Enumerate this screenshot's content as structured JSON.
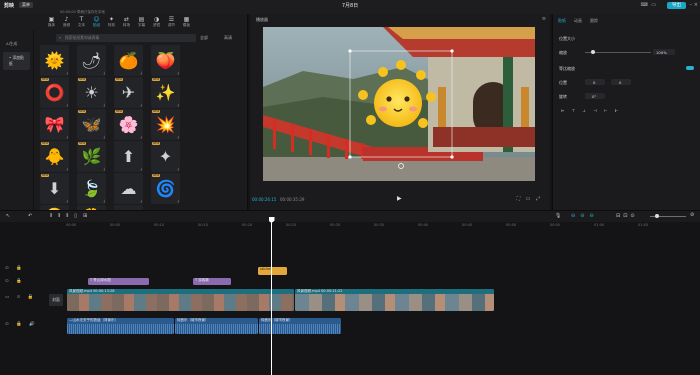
{
  "app": {
    "name": "剪映",
    "menu": "菜单",
    "project_title": "7月8日",
    "export": "导出",
    "autosave": "00:00:00 草稿已保存在本地"
  },
  "tools": [
    {
      "label": "媒体",
      "icon": "media-icon"
    },
    {
      "label": "音频",
      "icon": "audio-icon"
    },
    {
      "label": "文本",
      "icon": "text-icon"
    },
    {
      "label": "贴纸",
      "icon": "sticker-icon",
      "active": true
    },
    {
      "label": "特效",
      "icon": "effects-icon"
    },
    {
      "label": "转场",
      "icon": "transition-icon"
    },
    {
      "label": "字幕",
      "icon": "caption-icon"
    },
    {
      "label": "滤镜",
      "icon": "filter-icon"
    },
    {
      "label": "调节",
      "icon": "adjust-icon"
    },
    {
      "label": "模板",
      "icon": "template-icon"
    }
  ],
  "sidebar": {
    "ai": "AI生成",
    "items": [
      {
        "label": "• 添加贴纸",
        "active": true
      }
    ]
  },
  "search": {
    "placeholder": "搜索贴纸素材或表情"
  },
  "filters": {
    "all": "全部",
    "size": "高清"
  },
  "stickers": [
    {
      "emoji": "🌞",
      "badge": ""
    },
    {
      "emoji": "🌶",
      "badge": ""
    },
    {
      "emoji": "🍊",
      "badge": ""
    },
    {
      "emoji": "🍑",
      "badge": ""
    },
    {
      "emoji": "⭕",
      "badge": "NEW"
    },
    {
      "emoji": "☀",
      "badge": "NEW"
    },
    {
      "emoji": "✈",
      "badge": "NEW"
    },
    {
      "emoji": "✨",
      "badge": "NEW"
    },
    {
      "emoji": "🎀",
      "badge": ""
    },
    {
      "emoji": "🦋",
      "badge": "NEW"
    },
    {
      "emoji": "🌸",
      "badge": "NEW"
    },
    {
      "emoji": "💥",
      "badge": "NEW"
    },
    {
      "emoji": "🐥",
      "badge": "NEW"
    },
    {
      "emoji": "🌿",
      "badge": "NEW"
    },
    {
      "emoji": "⬆",
      "badge": ""
    },
    {
      "emoji": "✦",
      "badge": "NEW"
    },
    {
      "emoji": "⬇",
      "badge": "NEW"
    },
    {
      "emoji": "🍃",
      "badge": ""
    },
    {
      "emoji": "☁",
      "badge": ""
    },
    {
      "emoji": "🌀",
      "badge": "NEW"
    },
    {
      "emoji": "🟡",
      "badge": ""
    },
    {
      "emoji": "🌼",
      "badge": ""
    },
    {
      "emoji": "〰",
      "badge": ""
    }
  ],
  "player": {
    "title": "播放器",
    "timecode": "00:00:26:15",
    "duration": "00:00:35:29"
  },
  "props": {
    "tabs": [
      "贴纸",
      "动画",
      "跟踪"
    ],
    "section": "位置大小",
    "scale_label": "缩放",
    "scale_value": "100%",
    "uniform_label": "等比缩放",
    "position_label": "位置",
    "x_value": "0",
    "y_value": "0",
    "rotate_label": "旋转",
    "rotate_value": "0°",
    "align_label": "对齐"
  },
  "timeline": {
    "ruler": [
      "00:00",
      "00:05",
      "00:10",
      "00:15",
      "00:20",
      "00:25",
      "00:30",
      "00:35",
      "00:40",
      "00:45",
      "00:50",
      "00:55",
      "01:00",
      "01:05"
    ],
    "cover": "封面",
    "clips": {
      "sticker": "sticker",
      "text1": "T 青山绿水图",
      "text2": "T 游客篇",
      "video1": "风景视频.mp4  00:00:13:28",
      "video2": "风景视频.mp4  00:00:21:22",
      "audio1": "—山水无关乎的旅途（背景乐）",
      "audio2": "纯音乐（城市夜景）",
      "audio3": "纯音乐（城市夜景）"
    }
  }
}
